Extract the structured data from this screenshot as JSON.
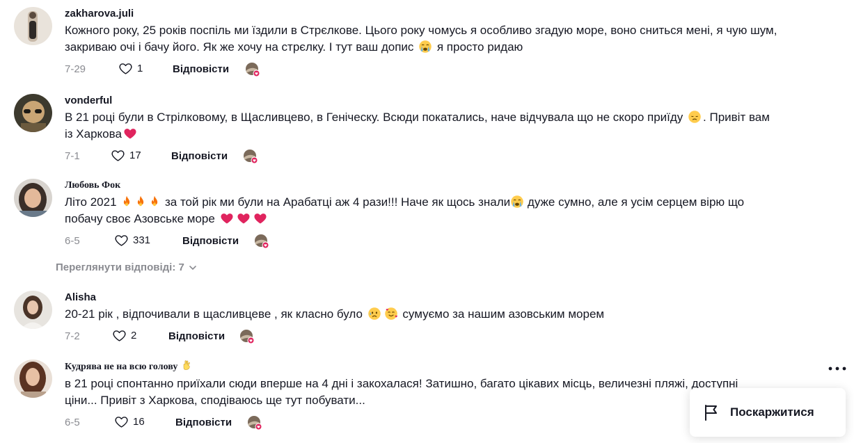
{
  "comments": [
    {
      "username": "zakharova.juli",
      "line1": "Кожного року, 25 років поспіль ми їздили в Стрєлкове. Цього року чомусь я особливо згадую море, воно сниться мені, я чую шум,",
      "line2a": "закриваю очі і бачу його. Як же хочу на стрєлку. І тут ваш допис ",
      "line2b": " я просто ридаю",
      "date": "7-29",
      "likes": "1",
      "reply": "Відповісти"
    },
    {
      "username": "vonderful",
      "line1a": "В 21 році були в Стрілковому, в Щасливцево, в Геніческу. Всюди покатались, наче відчувала що не скоро приїду ",
      "line1b": ". Привіт вам",
      "line2": "із Харкова",
      "date": "7-1",
      "likes": "17",
      "reply": "Відповісти"
    },
    {
      "username": "Любовь Фок",
      "line1a": "Літо 2021 ",
      "line1b": " за той рік ми були на Арабатці аж 4 рази!!! Наче як щось знали",
      "line1c": " дуже сумно, але я усім серцем вірю що",
      "line2": "побачу своє Азовське море ",
      "date": "6-5",
      "likes": "331",
      "reply": "Відповісти"
    },
    {
      "username": "Alisha",
      "line1a": "20-21 рік , відпочивали в щасливцеве , як класно було ",
      "line1b": " сумуємо за нашим азовським морем",
      "date": "7-2",
      "likes": "2",
      "reply": "Відповісти"
    },
    {
      "username": "Кудрява не на всю голову",
      "line1": "в 21 році спонтанно приїхали сюди вперше на 4 дні і закохалася! Затишно, багато цікавих місць, величезні пляжі, доступні",
      "line2": "ціни... Привіт з Харкова, сподіваюсь ще тут побувати...",
      "date": "6-5",
      "likes": "16",
      "reply": "Відповісти"
    }
  ],
  "view_replies": "Переглянути відповіді: 7",
  "report": "Поскаржитися",
  "icons": [
    "heart-outline-icon",
    "creator-liked-icon",
    "more-icon",
    "flag-icon",
    "chevron-down-icon"
  ],
  "colors": {
    "text": "#161823",
    "muted": "#8a8b91",
    "heart_red": "#e0245e"
  }
}
